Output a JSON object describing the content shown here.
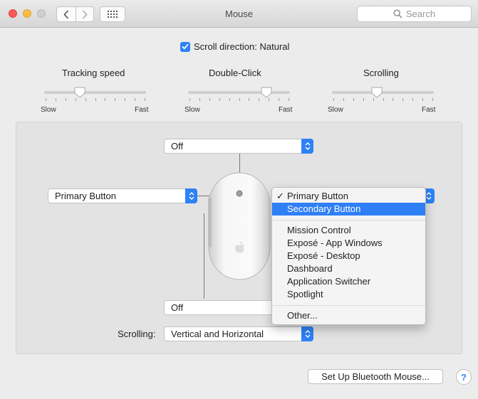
{
  "window": {
    "title": "Mouse",
    "search_placeholder": "Search"
  },
  "scroll_direction": {
    "label": "Scroll direction: Natural",
    "checked": true
  },
  "sliders": [
    {
      "title": "Tracking speed",
      "min_label": "Slow",
      "max_label": "Fast",
      "value": 0.35
    },
    {
      "title": "Double-Click",
      "min_label": "Slow",
      "max_label": "Fast",
      "value": 0.77
    },
    {
      "title": "Scrolling",
      "min_label": "Slow",
      "max_label": "Fast",
      "value": 0.44
    }
  ],
  "mouse_settings": {
    "top_button": "Off",
    "left_button": "Primary Button",
    "bottom_button": "Off",
    "scrolling_label": "Scrolling:",
    "scrolling_value": "Vertical and Horizontal"
  },
  "menu": {
    "items": [
      {
        "label": "Primary Button",
        "checked": true,
        "selected": false
      },
      {
        "label": "Secondary Button",
        "checked": false,
        "selected": true
      },
      {
        "label": "Mission Control",
        "checked": false,
        "selected": false
      },
      {
        "label": "Exposé - App Windows",
        "checked": false,
        "selected": false
      },
      {
        "label": "Exposé - Desktop",
        "checked": false,
        "selected": false
      },
      {
        "label": "Dashboard",
        "checked": false,
        "selected": false
      },
      {
        "label": "Application Switcher",
        "checked": false,
        "selected": false
      },
      {
        "label": "Spotlight",
        "checked": false,
        "selected": false
      },
      {
        "label": "Other...",
        "checked": false,
        "selected": false
      }
    ]
  },
  "bluetooth_button": "Set Up Bluetooth Mouse...",
  "help_label": "?",
  "colors": {
    "accent": "#2d82f6",
    "highlight": "#2f7ff6"
  },
  "icons": [
    "close-icon",
    "minimize-icon",
    "zoom-icon",
    "back-icon",
    "forward-icon",
    "grid-icon",
    "search-icon",
    "apple-logo-icon",
    "checkmark-icon"
  ]
}
